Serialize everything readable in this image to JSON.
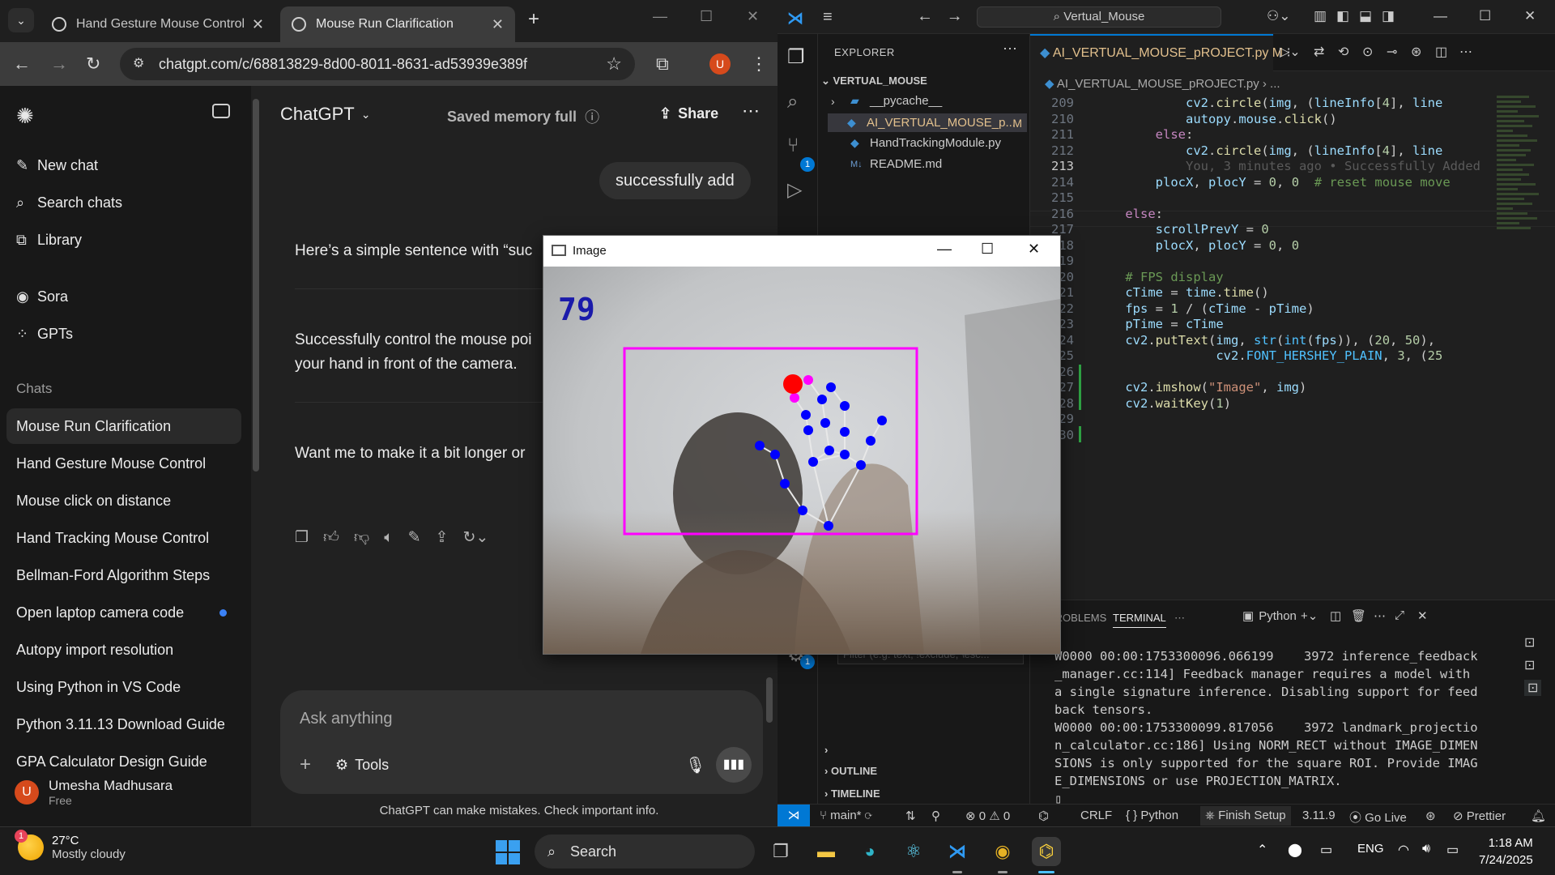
{
  "browser": {
    "tabs": [
      {
        "title": "Hand Gesture Mouse Control",
        "active": false
      },
      {
        "title": "Mouse Run Clarification",
        "active": true
      }
    ],
    "url": "chatgpt.com/c/68813829-8d00-8011-8631-ad53939e389f",
    "profile_initial": "U"
  },
  "chatgpt": {
    "sidebar": {
      "new_chat": "New chat",
      "search_chats": "Search chats",
      "library": "Library",
      "sora": "Sora",
      "gpts": "GPTs",
      "chats_header": "Chats",
      "chats": [
        "Mouse Run Clarification",
        "Hand Gesture Mouse Control",
        "Mouse click on distance",
        "Hand Tracking Mouse Control",
        "Bellman-Ford Algorithm Steps",
        "Open laptop camera code",
        "Autopy import resolution",
        "Using Python in VS Code",
        "Python 3.11.13 Download Guide",
        "GPA Calculator Design Guide"
      ],
      "user_name": "Umesha Madhusara",
      "user_plan": "Free",
      "user_initial": "U"
    },
    "header": {
      "model": "ChatGPT",
      "memory": "Saved memory full",
      "share": "Share"
    },
    "user_message": "successfully add",
    "assistant": {
      "line1": "Here’s a simple sentence with “suc",
      "line2a": "Successfully control the mouse poi",
      "line2b": "your hand in front of the camera.",
      "line3": "Want me to make it a bit longer or"
    },
    "composer": {
      "placeholder": "Ask anything",
      "tools": "Tools"
    },
    "disclaimer": "ChatGPT can make mistakes. Check important info."
  },
  "vscode": {
    "search": "Vertual_Mouse",
    "explorer": {
      "header": "EXPLORER",
      "root": "VERTUAL_MOUSE",
      "items": [
        "__pycache__",
        "AI_VERTUAL_MOUSE_p...",
        "HandTrackingModule.py",
        "README.md"
      ],
      "modified_marker": "M",
      "filter_placeholder": "Filter (e.g. text, !exclude, \\esc...",
      "outline": "OUTLINE",
      "timeline": "TIMELINE"
    },
    "editor": {
      "tab": "AI_VERTUAL_MOUSE_pROJECT.py",
      "tab_marker": "M",
      "breadcrumb": "AI_VERTUAL_MOUSE_pROJECT.py",
      "line_numbers": [
        "209",
        "210",
        "211",
        "212",
        "213",
        "214",
        "215",
        "216",
        "217",
        "218",
        "219",
        "220",
        "221",
        "222",
        "223",
        "224",
        "225",
        "226",
        "227",
        "228",
        "229",
        "230"
      ],
      "current_line": "213",
      "blame": "You, 3 minutes ago • Successfully Added"
    },
    "panel": {
      "tabs": [
        "PROBLEMS",
        "TERMINAL"
      ],
      "active_tab": "TERMINAL",
      "shell": "Python",
      "terminal_lines": [
        "W0000 00:00:1753300096.066199    3972 inference_feedback",
        "_manager.cc:114] Feedback manager requires a model with",
        "a single signature inference. Disabling support for feed",
        "back tensors.",
        "W0000 00:00:1753300099.817056    3972 landmark_projectio",
        "n_calculator.cc:186] Using NORM_RECT without IMAGE_DIMEN",
        "SIONS is only supported for the square ROI. Provide IMAG",
        "E_DIMENSIONS or use PROJECTION_MATRIX."
      ]
    },
    "status": {
      "branch": "main*",
      "errors": "0",
      "warnings": "0",
      "eol": "CRLF",
      "language": "Python",
      "finish_setup": "Finish Setup",
      "version": "3.11.9",
      "go_live": "Go Live",
      "prettier": "Prettier"
    },
    "badges": {
      "scm": "1",
      "settings": "1"
    }
  },
  "opencv": {
    "title": "Image",
    "fps": "79",
    "box_color": "#ff00ff",
    "landmark_color": "#0000ff",
    "click_color": "#ff0000"
  },
  "taskbar": {
    "temperature": "27°C",
    "weather": "Mostly cloudy",
    "weather_badge": "1",
    "search": "Search",
    "language": "ENG",
    "time": "1:18 AM",
    "date": "7/24/2025"
  }
}
